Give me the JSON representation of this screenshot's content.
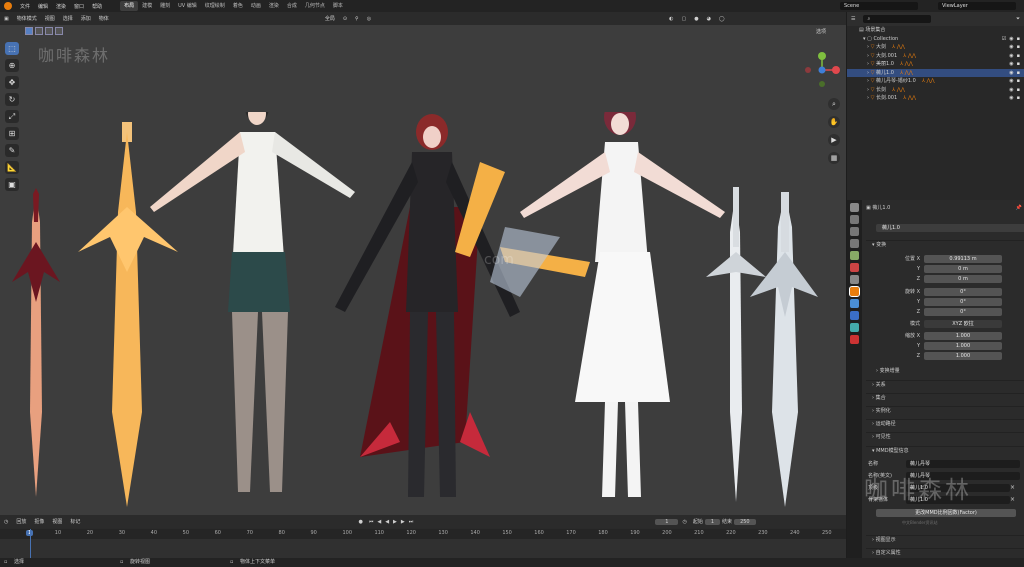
{
  "topbar": {
    "menus": [
      "文件",
      "编辑",
      "渲染",
      "窗口",
      "帮助"
    ],
    "workspaces": [
      "布局",
      "建模",
      "雕刻",
      "UV 编辑",
      "纹理绘制",
      "着色",
      "动画",
      "渲染",
      "合成",
      "几何节点",
      "脚本"
    ],
    "active_workspace": "布局",
    "scene_label": "Scene",
    "viewlayer_label": "ViewLayer"
  },
  "viewport": {
    "mode": "物体模式",
    "menus": [
      "视图",
      "选择",
      "添加",
      "物体"
    ],
    "transform": "全局",
    "options": "选项",
    "watermark": "咖啡森林",
    "overlay_text": "com"
  },
  "outliner": {
    "root": "场景集合",
    "collection": "Collection",
    "items": [
      {
        "name": "大剑",
        "selected": false
      },
      {
        "name": "大剑.001",
        "selected": false
      },
      {
        "name": "美丽1.0",
        "selected": false
      },
      {
        "name": "薇儿1.0",
        "selected": true
      },
      {
        "name": "薇儿丹琴-婚纱1.0",
        "selected": false
      },
      {
        "name": "长剑",
        "selected": false
      },
      {
        "name": "长剑.001",
        "selected": false
      }
    ]
  },
  "properties": {
    "object_name": "薇儿1.0",
    "object_name2": "薇儿1.0",
    "transform_label": "变换",
    "location_label": "位置 X",
    "loc_x": "0.99113 m",
    "loc_y": "0 m",
    "loc_z": "0 m",
    "rotation_label": "旋转 X",
    "rot_x": "0°",
    "rot_y": "0°",
    "rot_z": "0°",
    "mode_label": "模式",
    "mode_value": "XYZ 欧拉",
    "scale_label": "缩放 X",
    "scale_x": "1.000",
    "scale_y": "1.000",
    "scale_z": "1.000",
    "y_label": "Y",
    "z_label": "Z",
    "delta": "变换增量",
    "sections": [
      "关系",
      "集合",
      "实例化",
      "运动路径",
      "可见性"
    ],
    "mmd_section": "MMD模型信息",
    "mmd_name_label": "名称",
    "mmd_name": "薇儿丹琴",
    "mmd_name_en_label": "名称(英文)",
    "mmd_name_en": "薇儿丹琴",
    "mmd_root_label": "顶级",
    "mmd_root": "薇儿1.0",
    "mmd_parent_label": "骨架物体",
    "mmd_parent": "薇儿1.0",
    "mmd_button": "更改MMD比例因数(Factor)",
    "bottom_sections": [
      "视图显示",
      "自定义属性"
    ],
    "watermark": "咖啡森林",
    "watermark_sub": "中文Blender资讯站"
  },
  "timeline": {
    "menus": [
      "回放",
      "抠像",
      "视图",
      "标记"
    ],
    "current_frame": "1",
    "start_label": "起始",
    "start": "1",
    "end_label": "结束",
    "end": "250",
    "ruler": [
      "1",
      "10",
      "20",
      "30",
      "40",
      "50",
      "60",
      "70",
      "80",
      "90",
      "100",
      "110",
      "120",
      "130",
      "140",
      "150",
      "160",
      "170",
      "180",
      "190",
      "200",
      "210",
      "220",
      "230",
      "240",
      "250"
    ]
  },
  "statusbar": {
    "left": "选择",
    "middle": "旋转视图",
    "right": "物体上下文菜单"
  },
  "colors": {
    "accent": "#4772b3",
    "selected_row": "#334d80",
    "orange_icon": "#e87d0d"
  }
}
